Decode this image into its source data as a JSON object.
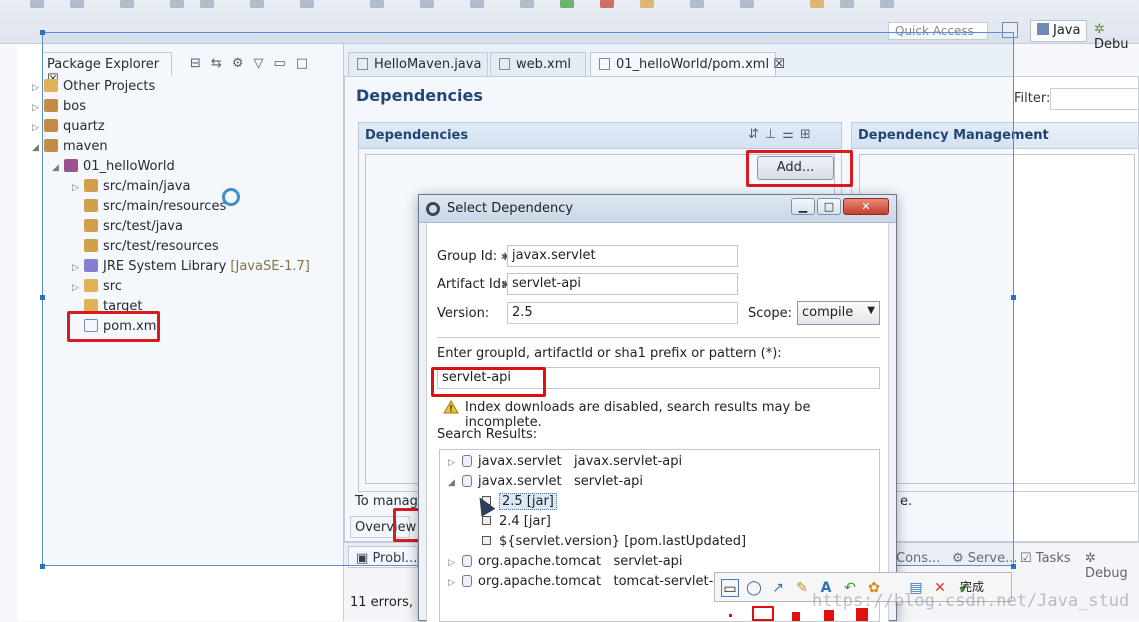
{
  "toolbar": {
    "quick_access": "Quick Access",
    "perspectives": [
      "Java",
      "Debu"
    ]
  },
  "package_explorer": {
    "title": "Package Explorer",
    "items": [
      {
        "label": "Other Projects",
        "depth": 0,
        "expander": "▷"
      },
      {
        "label": "bos",
        "depth": 0,
        "expander": "▷"
      },
      {
        "label": "quartz",
        "depth": 0,
        "expander": "▷"
      },
      {
        "label": "maven",
        "depth": 0,
        "expander": "◢"
      },
      {
        "label": "01_helloWorld",
        "depth": 1,
        "expander": "◢"
      },
      {
        "label": "src/main/java",
        "depth": 2,
        "expander": "▷"
      },
      {
        "label": "src/main/resources",
        "depth": 2,
        "expander": ""
      },
      {
        "label": "src/test/java",
        "depth": 2,
        "expander": ""
      },
      {
        "label": "src/test/resources",
        "depth": 2,
        "expander": ""
      },
      {
        "label": "JRE System Library",
        "decoration": "[JavaSE-1.7]",
        "depth": 2,
        "expander": "▷"
      },
      {
        "label": "src",
        "depth": 2,
        "expander": "▷"
      },
      {
        "label": "target",
        "depth": 2,
        "expander": ""
      },
      {
        "label": "pom.xml",
        "depth": 2,
        "expander": ""
      }
    ]
  },
  "editor": {
    "tabs": [
      "HelloMaven.java",
      "web.xml",
      "01_helloWorld/pom.xml"
    ],
    "page_title": "Dependencies",
    "filter_label": "Filter:",
    "dependencies_section": "Dependencies",
    "dependency_management_section": "Dependency Management",
    "add_button": "Add...",
    "bottom_text_left": "To manage",
    "bottom_text_right": "e.",
    "overview_tab": "Overview"
  },
  "bottom_panel": {
    "tabs": [
      "Probl...",
      "Cons...",
      "Serve...",
      "Tasks",
      "Debug"
    ],
    "status": "11 errors, 1"
  },
  "dialog": {
    "title": "Select Dependency",
    "group_id_label": "Group Id:",
    "group_id_value": "javax.servlet",
    "artifact_id_label": "Artifact Id:",
    "artifact_id_value": "servlet-api",
    "version_label": "Version:",
    "version_value": "2.5",
    "scope_label": "Scope:",
    "scope_value": "compile",
    "search_label": "Enter groupId, artifactId or sha1 prefix or pattern (*):",
    "search_value": "servlet-api",
    "warning": "Index downloads are disabled, search results may be incomplete.",
    "results_label": "Search Results:",
    "results": [
      {
        "group": "javax.servlet",
        "artifact": "javax.servlet-api",
        "expander": "▷"
      },
      {
        "group": "javax.servlet",
        "artifact": "servlet-api",
        "expander": "◢"
      },
      {
        "version": "2.5 [jar]",
        "selected": true
      },
      {
        "version": "2.4 [jar]"
      },
      {
        "version": "${servlet.version} [pom.lastUpdated]"
      },
      {
        "group": "org.apache.tomcat",
        "artifact": "servlet-api",
        "expander": "▷"
      },
      {
        "group": "org.apache.tomcat",
        "artifact": "tomcat-servlet-api",
        "expander": "▷"
      }
    ]
  },
  "snip_toolbar": {
    "done_label": "完成"
  },
  "watermark": "https://blog.csdn.net/Java_stud"
}
